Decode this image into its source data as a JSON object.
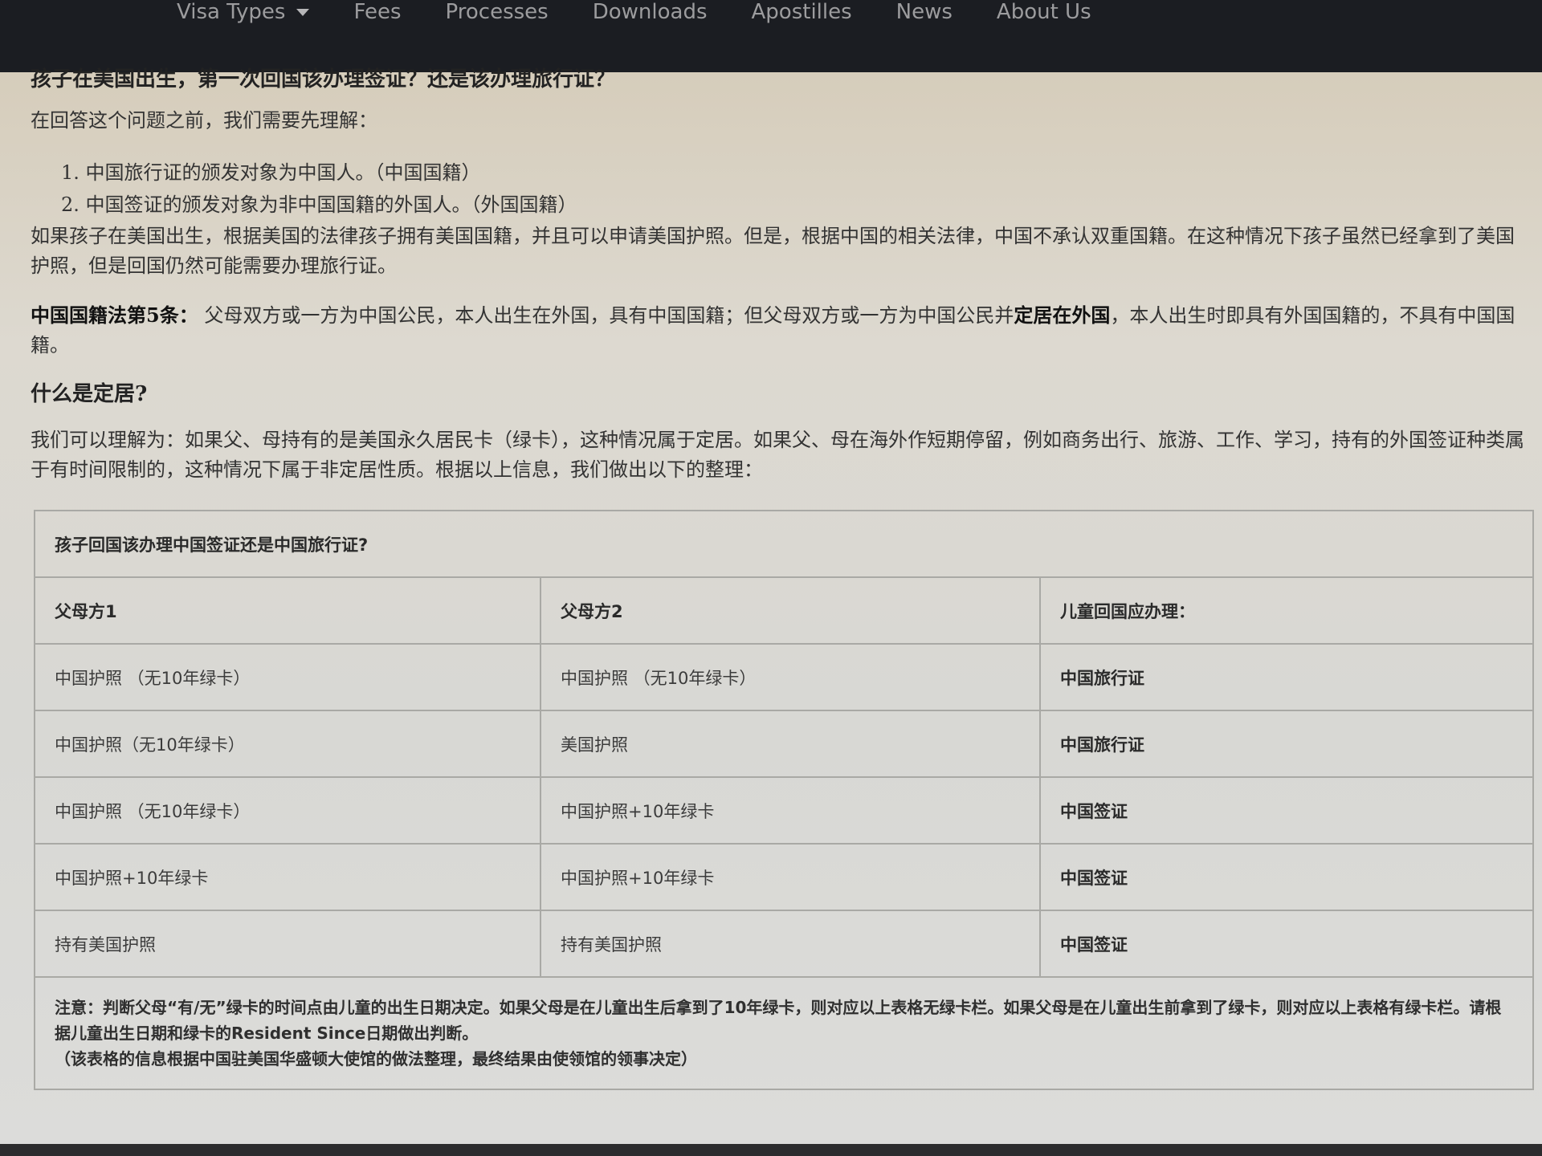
{
  "nav": {
    "items": [
      {
        "label": "Visa Types",
        "has_dropdown": true
      },
      {
        "label": "Fees"
      },
      {
        "label": "Processes"
      },
      {
        "label": "Downloads"
      },
      {
        "label": "Apostilles"
      },
      {
        "label": "News"
      },
      {
        "label": "About Us"
      }
    ]
  },
  "article": {
    "partial_heading": "孩子在美国出生，第一次回国该办理签证？还是该办理旅行证？",
    "intro": "在回答这个问题之前，我们需要先理解：",
    "list": [
      "中国旅行证的颁发对象为中国人。（中国国籍）",
      "中国签证的颁发对象为非中国国籍的外国人。（外国国籍）"
    ],
    "list_numbers": [
      "1.",
      "2."
    ],
    "para1": "如果孩子在美国出生，根据美国的法律孩子拥有美国国籍，并且可以申请美国护照。但是，根据中国的相关法律，中国不承认双重国籍。在这种情况下孩子虽然已经拿到了美国护照，但是回国仍然可能需要办理旅行证。",
    "law_label": "中国国籍法第5条：",
    "law_text_a": "父母双方或一方为中国公民，本人出生在外国，具有中国国籍；但父母双方或一方为中国公民并",
    "law_emphasis": "定居在外国",
    "law_text_b": "，本人出生时即具有外国国籍的，不具有中国国籍。",
    "subheading": "什么是定居?",
    "para3": "我们可以理解为：如果父、母持有的是美国永久居民卡（绿卡），这种情况属于定居。如果父、母在海外作短期停留，例如商务出行、旅游、工作、学习，持有的外国签证种类属于有时间限制的，这种情况下属于非定居性质。根据以上信息，我们做出以下的整理："
  },
  "table": {
    "caption": "孩子回国该办理中国签证还是中国旅行证?",
    "headers": [
      "父母方1",
      "父母方2",
      "儿童回国应办理："
    ],
    "rows": [
      [
        "中国护照 （无10年绿卡）",
        "中国护照 （无10年绿卡）",
        "中国旅行证"
      ],
      [
        "中国护照（无10年绿卡）",
        "美国护照",
        "中国旅行证"
      ],
      [
        "中国护照 （无10年绿卡）",
        "中国护照+10年绿卡",
        "中国签证"
      ],
      [
        "中国护照+10年绿卡",
        "中国护照+10年绿卡",
        "中国签证"
      ],
      [
        "持有美国护照",
        "持有美国护照",
        "中国签证"
      ]
    ],
    "note_line1": "注意：判断父母“有/无”绿卡的时间点由儿童的出生日期决定。如果父母是在儿童出生后拿到了10年绿卡，则对应以上表格无绿卡栏。如果父母是在儿童出生前拿到了绿卡，则对应以上表格有绿卡栏。请根据儿童出生日期和绿卡的Resident Since日期做出判断。",
    "note_line2": "（该表格的信息根据中国驻美国华盛顿大使馆的做法整理，最终结果由使领馆的领事决定）"
  }
}
